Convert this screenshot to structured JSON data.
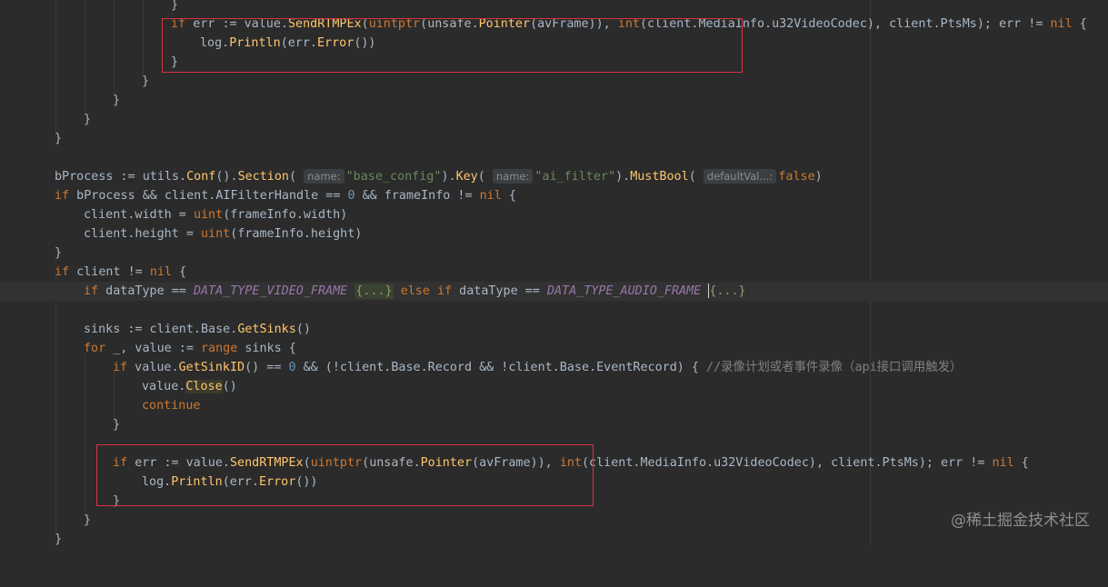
{
  "code_lines": [
    {
      "t": "}"
    },
    {
      "t": "if err := value.SendRTMPEx(uintptr(unsafe.Pointer(avFrame)), int(client.MediaInfo.u32VideoCodec), client.PtsMs); err != nil {"
    },
    {
      "t": "log.Println(err.Error())"
    },
    {
      "t": "}"
    },
    {
      "t": "}"
    },
    {
      "t": "}"
    },
    {
      "t": "}"
    },
    {
      "t": "}"
    },
    {
      "t": ""
    },
    {
      "t": "bProcess := utils.Conf().Section(",
      "hint1": "name:",
      "s1": "\"base_config\"",
      "t2": ").Key(",
      "hint2": "name:",
      "s2": "\"ai_filter\"",
      "t3": ").MustBool(",
      "hint3": "defaultVal...:",
      "t4": "false)"
    },
    {
      "t": "if bProcess && client.AIFilterHandle == 0 && frameInfo != nil {"
    },
    {
      "t": "client.width = uint(frameInfo.width)"
    },
    {
      "t": "client.height = uint(frameInfo.height)"
    },
    {
      "t": "}"
    },
    {
      "t": "if client != nil {"
    },
    {
      "t": "if dataType == DATA_TYPE_VIDEO_FRAME {...} else if dataType == DATA_TYPE_AUDIO_FRAME {...}"
    },
    {
      "t": ""
    },
    {
      "t": "sinks := client.Base.GetSinks()"
    },
    {
      "t": "for _, value := range sinks {"
    },
    {
      "t": "if value.GetSinkID() == 0 && (!client.Base.Record && !client.Base.EventRecord) { //录像计划或者事件录像（api接口调用触发）"
    },
    {
      "t": "value.Close()"
    },
    {
      "t": "continue"
    },
    {
      "t": "}"
    },
    {
      "t": ""
    },
    {
      "t": "if err := value.SendRTMPEx(uintptr(unsafe.Pointer(avFrame)), int(client.MediaInfo.u32VideoCodec), client.PtsMs); err != nil {"
    },
    {
      "t": "log.Println(err.Error())"
    },
    {
      "t": "}"
    },
    {
      "t": "}"
    },
    {
      "t": "}"
    }
  ],
  "tokens": {
    "if": "if",
    "err": "err",
    "walrus": ":=",
    "value_send": "value.",
    "SendRTMPEx": "SendRTMPEx",
    "uintptr": "uintptr",
    "unsafe": "unsafe",
    "Pointer": "Pointer",
    "avFrame": "(avFrame)), ",
    "int": "int",
    "codec": "(client.MediaInfo.u32VideoCodec), client.PtsMs); err != ",
    "nil": "nil",
    "brace": " {",
    "log": "log.",
    "Println": "Println",
    "err_error": "(err.",
    "Error": "Error",
    "close_paren": "())",
    "bProcess": "bProcess := ",
    "utils": "utils.",
    "Conf": "Conf",
    "section_call": "().",
    "Section": "Section",
    "paren_open": "( ",
    "hint_name": "name:",
    "base_config": "\"base_config\"",
    "key_dot": ").",
    "Key": "Key",
    "ai_filter": "\"ai_filter\"",
    "MustBool": "MustBool",
    "hint_default": "defaultVal...:",
    "false": "false",
    "end_paren": ")",
    "if_bprocess": " bProcess && client.AIFilterHandle == ",
    "zero": "0",
    "and_frame": " && frameInfo != ",
    "client_width": "client.width = ",
    "uint": "uint",
    "frame_width": "(frameInfo.width)",
    "client_height": "client.height = ",
    "frame_height": "(frameInfo.height)",
    "client_ne": " client != ",
    "datatype_eq": " dataType == ",
    "VIDEO": "DATA_TYPE_VIDEO_FRAME",
    "fold": "{...}",
    "else": "else",
    "AUDIO": "DATA_TYPE_AUDIO_FRAME",
    "sinks": "sinks := client.Base.",
    "GetSinks": "GetSinks",
    "empty_call": "()",
    "for": "for",
    "range_pre": " _, value := ",
    "range": "range",
    "sinks_brace": " sinks {",
    "getsink_pre": " value.",
    "GetSinkID": "GetSinkID",
    "getsink_post": "() == ",
    "record": " && (!client.Base.Record && !client.Base.EventRecord) { ",
    "comment": "//录像计划或者事件录像（api接口调用触发）",
    "value_close": "value.",
    "Close": "Close",
    "continue": "continue",
    "rbrace": "}"
  },
  "watermark": "@稀土掘金技术社区",
  "colors": {
    "background": "#2b2b2b",
    "keyword": "#cc7832",
    "function": "#ffc66d",
    "string": "#6a8759",
    "number": "#6897bb",
    "constant": "#9876aa",
    "comment": "#808080",
    "highlight_box": "#d9333f"
  }
}
